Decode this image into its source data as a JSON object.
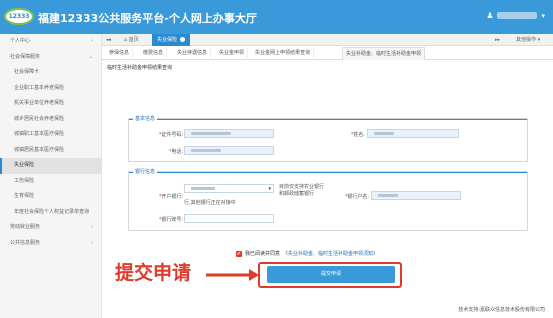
{
  "header": {
    "logo": "12333",
    "title": "福建12333公共服务平台-个人网上办事大厅",
    "user_icon": "user-icon"
  },
  "sidebar": {
    "items": [
      {
        "label": "个人中心",
        "arrow": "›"
      },
      {
        "label": "社会保障服务",
        "arrow": "⌄"
      },
      {
        "label": "社会保障卡"
      },
      {
        "label": "企业职工基本养老保险"
      },
      {
        "label": "机关事业单位养老保险"
      },
      {
        "label": "城乡居民社会养老保险"
      },
      {
        "label": "城镇职工基本医疗保险"
      },
      {
        "label": "城镇居民基本医疗保险"
      },
      {
        "label": "失业保险"
      },
      {
        "label": "工伤保险"
      },
      {
        "label": "生育保险"
      },
      {
        "label": "年度社会保险个人权益记录单查询"
      },
      {
        "label": "劳动就业服务",
        "arrow": "›"
      },
      {
        "label": "公共信息服务",
        "arrow": "›"
      }
    ]
  },
  "tabbar": {
    "nav_prev": "◂◂",
    "home": "首页",
    "active_tab": "失业保险",
    "nav_next": "▸▸",
    "other_ops": "其他操作 ▾"
  },
  "nav_tabs": [
    "参保信息",
    "缴费信息",
    "失业待遇信息",
    "失业金申领",
    "失业金网上申领结果查询",
    "失业补助金、临时生活补助金申领",
    "临时生活补助金申领结果查询"
  ],
  "subtitle": "失业补助金、临时生活补助金申领结果查询",
  "basic": {
    "legend": "基本信息",
    "id_label": "证件号码:",
    "name_label": "姓名:",
    "phone_label": "电话:"
  },
  "bank": {
    "legend": "银行信息",
    "bank_label": "开户银行:",
    "bank_note": "目前仅支持农业银行和邮政储蓄银行",
    "other_note": "行,其他银行正在对接中",
    "account_name_label": "银行户名:",
    "account_label": "银行账号:",
    "select_arrow": "▾"
  },
  "agreement": {
    "check": "✔",
    "text": "我已阅读并同意",
    "link": "《失业补助金、临时生活补助金申领须知》"
  },
  "submit_label": "提交申请",
  "annotation": "提交申请",
  "footer": "技术支持:嘉联众信息技术股份有限公司"
}
